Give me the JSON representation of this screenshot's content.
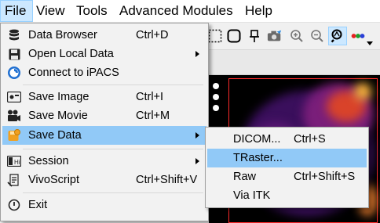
{
  "menubar": {
    "items": [
      {
        "label": "File"
      },
      {
        "label": "View"
      },
      {
        "label": "Tools"
      },
      {
        "label": "Advanced Modules"
      },
      {
        "label": "Help"
      }
    ]
  },
  "toolbar": {
    "icons": [
      "select-rect-icon",
      "rounded-rect-icon",
      "pin-icon",
      "camera-icon",
      "zoom-in-icon",
      "zoom-out-icon",
      "zoom-fit-icon",
      "color-dots-icon",
      "dropdown-arrow-icon"
    ]
  },
  "file_menu": {
    "items": [
      {
        "label": "Data Browser",
        "shortcut": "Ctrl+D",
        "icon": "database-icon"
      },
      {
        "label": "Open Local Data",
        "shortcut": "",
        "icon": "floppy-icon",
        "submenu": true
      },
      {
        "label": "Connect to iPACS",
        "shortcut": "",
        "icon": "ipacs-icon"
      },
      {
        "label": "Save Image",
        "shortcut": "Ctrl+I",
        "icon": "image-icon"
      },
      {
        "label": "Save Movie",
        "shortcut": "Ctrl+M",
        "icon": "movie-camera-icon"
      },
      {
        "label": "Save Data",
        "shortcut": "",
        "icon": "save-data-icon",
        "submenu": true
      },
      {
        "label": "Session",
        "shortcut": "",
        "icon": "session-icon",
        "submenu": true
      },
      {
        "label": "VivoScript",
        "shortcut": "Ctrl+Shift+V",
        "icon": "script-icon"
      },
      {
        "label": "Exit",
        "shortcut": "",
        "icon": "exit-icon"
      }
    ]
  },
  "save_data_menu": {
    "items": [
      {
        "label": "DICOM...",
        "shortcut": "Ctrl+S"
      },
      {
        "label": "TRaster...",
        "shortcut": ""
      },
      {
        "label": "Raw",
        "shortcut": "Ctrl+Shift+S"
      },
      {
        "label": "Via ITK",
        "shortcut": ""
      }
    ]
  },
  "colors": {
    "highlight": "#91c9f7",
    "menubar_active": "#cce8ff",
    "viewport_border": "#ff2a2a"
  }
}
